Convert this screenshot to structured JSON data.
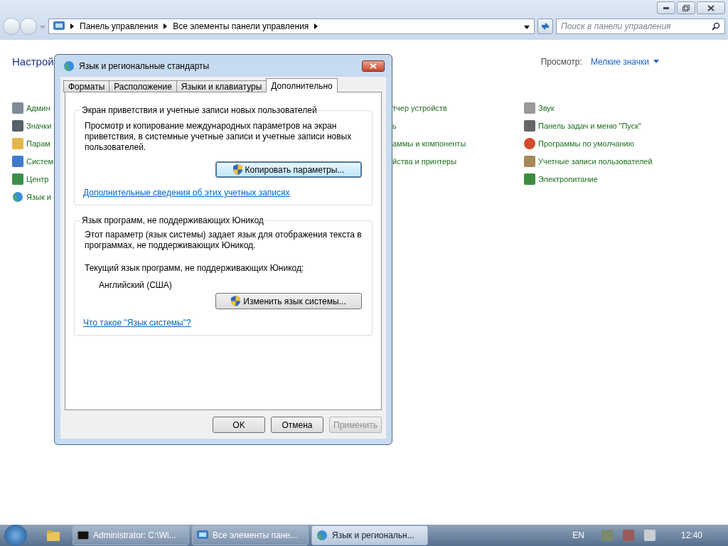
{
  "address_bar": {
    "path": [
      "Панель управления",
      "Все элементы панели управления"
    ]
  },
  "search": {
    "placeholder": "Поиск в панели управления"
  },
  "header": {
    "title": "Настрой",
    "view_label": "Просмотр:",
    "view_value": "Мелкие значки"
  },
  "columns": [
    [
      {
        "label": "Админ"
      },
      {
        "label": "Значки"
      },
      {
        "label": "Парам"
      },
      {
        "label": "Систем"
      },
      {
        "label": "Центр"
      },
      {
        "label": "Язык и"
      }
    ],
    [
      {
        "label": "тчер устройств"
      },
      {
        "label": "ь"
      },
      {
        "label": "аммы и компоненты"
      },
      {
        "label": "йства и принтеры"
      }
    ],
    [
      {
        "label": "Звук"
      },
      {
        "label": "Панель задач и меню \"Пуск\""
      },
      {
        "label": "Программы по умолчанию"
      },
      {
        "label": "Учетные записи пользователей"
      },
      {
        "label": "Электропитание"
      }
    ]
  ],
  "dialog": {
    "title": "Язык и региональные стандарты",
    "tabs": [
      {
        "label": "Форматы",
        "selected": false
      },
      {
        "label": "Расположение",
        "selected": false
      },
      {
        "label": "Языки и клавиатуры",
        "selected": false
      },
      {
        "label": "Дополнительно",
        "selected": true
      }
    ],
    "welcome_group": {
      "title": "Экран приветствия и учетные записи новых пользователей",
      "text": "Просмотр и копирование международных параметров на экран приветствия, в системные учетные записи и учетные записи новых пользователей.",
      "button": "Копировать параметры...",
      "link": "Дополнительные сведения об этих учетных записях"
    },
    "unicode_group": {
      "title": "Язык программ, не поддерживающих Юникод",
      "text": "Этот параметр (язык системы) задает язык для отображения текста в программах, не поддерживающих Юникод.",
      "current_label": "Текущий язык программ, не поддерживающих Юникод:",
      "current_value": "Английский (США)",
      "button": "Изменить язык системы...",
      "link": "Что такое \"Язык системы\"?"
    },
    "buttons": [
      {
        "label": "OK",
        "disabled": false
      },
      {
        "label": "Отмена",
        "disabled": false
      },
      {
        "label": "Применить",
        "disabled": true
      }
    ]
  },
  "taskbar": {
    "tasks": [
      {
        "label": "Administrator: C:\\Wi...",
        "kind": "console",
        "selected": false
      },
      {
        "label": "Все элементы пане...",
        "kind": "panel",
        "selected": false
      },
      {
        "label": "Язык и региональн...",
        "kind": "globe",
        "selected": true
      }
    ],
    "language": "EN",
    "time": "12:40"
  }
}
